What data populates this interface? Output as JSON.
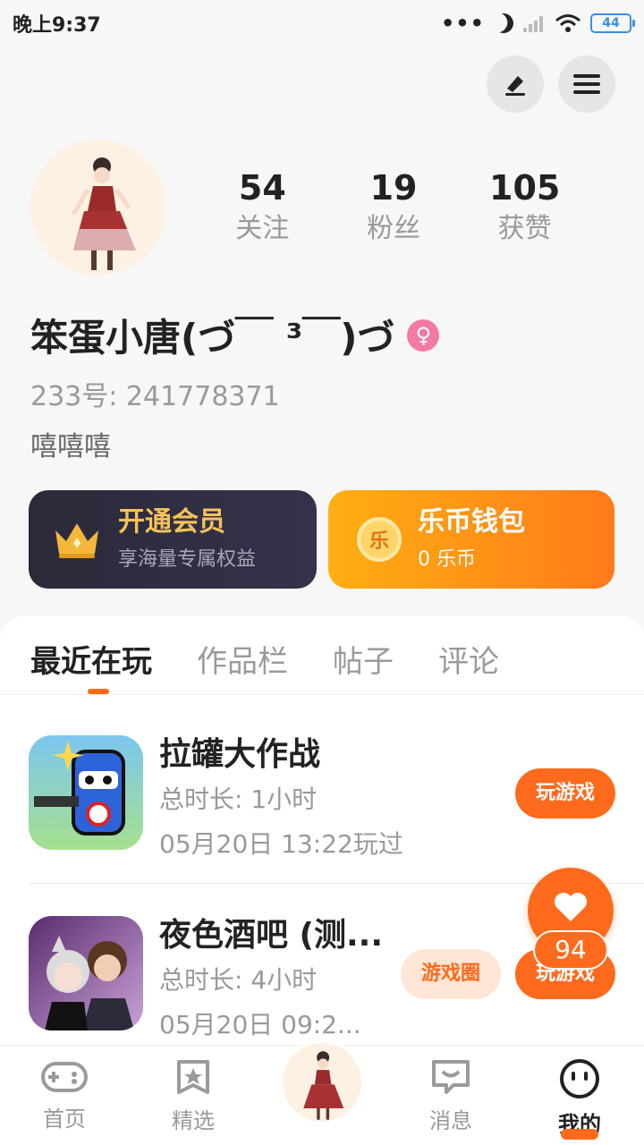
{
  "status_bar": {
    "time": "晚上9:37",
    "signal_dots": "•••",
    "battery": "44"
  },
  "profile": {
    "stats": [
      {
        "num": "54",
        "label": "关注"
      },
      {
        "num": "19",
        "label": "粉丝"
      },
      {
        "num": "105",
        "label": "获赞"
      }
    ],
    "username": "笨蛋小唐(づ￣ ³￣)づ",
    "gender_symbol": "♀",
    "uid": "233号: 241778371",
    "bio": "嘻嘻嘻"
  },
  "cards": {
    "vip_title": "开通会员",
    "vip_sub": "享海量专属权益",
    "wallet_title": "乐币钱包",
    "wallet_sub": "0 乐币",
    "wallet_coin": "乐"
  },
  "tabs": [
    "最近在玩",
    "作品栏",
    "帖子",
    "评论"
  ],
  "games": [
    {
      "name": "拉罐大作战",
      "duration": "总时长: 1小时",
      "last_played": "05月20日 13:22玩过",
      "play_label": "玩游戏"
    },
    {
      "name": "夜色酒吧 (测...",
      "duration": "总时长: 4小时",
      "last_played": "05月20日 09:2...",
      "play_label": "玩游戏",
      "circle_label": "游戏圈"
    }
  ],
  "float_like_count": "94",
  "nav": {
    "home": "首页",
    "featured": "精选",
    "messages": "消息",
    "mine": "我的"
  },
  "colors": {
    "accent": "#ff6a1c",
    "vip_gold": "#f5c25a"
  }
}
